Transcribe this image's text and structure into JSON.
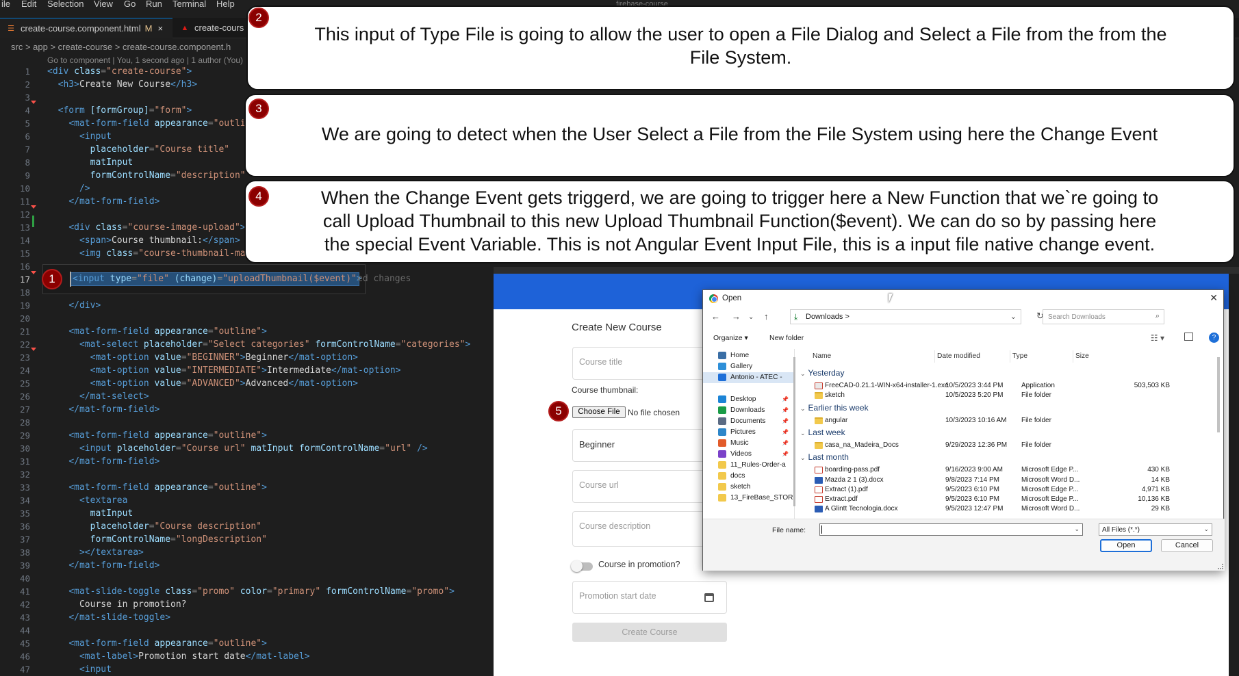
{
  "menu": [
    "ile",
    "Edit",
    "Selection",
    "View",
    "Go",
    "Run",
    "Terminal",
    "Help"
  ],
  "window_title": "firebase-course",
  "tabs": [
    {
      "label": "create-course.component.html",
      "modified": "M",
      "close": "×",
      "active": true
    },
    {
      "label": "create-cours",
      "active": false
    }
  ],
  "breadcrumbs": "src > app > create-course > create-course.component.h",
  "blame": "Go to component | You, 1 second ago | 1 author (You)",
  "code_lines": [
    [
      [
        "t",
        "<div "
      ],
      [
        "a",
        "class"
      ],
      [
        "p",
        "="
      ],
      [
        "s",
        "\"create-course\""
      ],
      [
        "t",
        ">"
      ]
    ],
    [
      [
        "x",
        "  "
      ],
      [
        "t",
        "<h3>"
      ],
      [
        "x",
        "Create New Course"
      ],
      [
        "t",
        "</h3>"
      ]
    ],
    [],
    [
      [
        "x",
        "  "
      ],
      [
        "t",
        "<form "
      ],
      [
        "a",
        "[formGroup]"
      ],
      [
        "p",
        "="
      ],
      [
        "s",
        "\"form\""
      ],
      [
        "t",
        ">"
      ]
    ],
    [
      [
        "x",
        "    "
      ],
      [
        "t",
        "<mat-form-field "
      ],
      [
        "a",
        "appearance"
      ],
      [
        "p",
        "="
      ],
      [
        "s",
        "\"outlin"
      ]
    ],
    [
      [
        "x",
        "      "
      ],
      [
        "t",
        "<input"
      ]
    ],
    [
      [
        "x",
        "        "
      ],
      [
        "a",
        "placeholder"
      ],
      [
        "p",
        "="
      ],
      [
        "s",
        "\"Course title\""
      ]
    ],
    [
      [
        "x",
        "        "
      ],
      [
        "a",
        "matInput"
      ]
    ],
    [
      [
        "x",
        "        "
      ],
      [
        "a",
        "formControlName"
      ],
      [
        "p",
        "="
      ],
      [
        "s",
        "\"description\""
      ]
    ],
    [
      [
        "x",
        "      "
      ],
      [
        "t",
        "/>"
      ]
    ],
    [
      [
        "x",
        "    "
      ],
      [
        "t",
        "</mat-form-field>"
      ]
    ],
    [],
    [
      [
        "x",
        "    "
      ],
      [
        "t",
        "<div "
      ],
      [
        "a",
        "class"
      ],
      [
        "p",
        "="
      ],
      [
        "s",
        "\"course-image-upload\""
      ],
      [
        "t",
        ">"
      ]
    ],
    [
      [
        "x",
        "      "
      ],
      [
        "t",
        "<span>"
      ],
      [
        "x",
        "Course thumbnail:"
      ],
      [
        "t",
        "</span>"
      ]
    ],
    [
      [
        "x",
        "      "
      ],
      [
        "t",
        "<img "
      ],
      [
        "a",
        "class"
      ],
      [
        "p",
        "="
      ],
      [
        "s",
        "\"course-thumbnail-ma"
      ]
    ],
    [],
    [],
    [],
    [
      [
        "x",
        "    "
      ],
      [
        "t",
        "</div>"
      ]
    ],
    [],
    [
      [
        "x",
        "    "
      ],
      [
        "t",
        "<mat-form-field "
      ],
      [
        "a",
        "appearance"
      ],
      [
        "p",
        "="
      ],
      [
        "s",
        "\"outline\""
      ],
      [
        "t",
        ">"
      ]
    ],
    [
      [
        "x",
        "      "
      ],
      [
        "t",
        "<mat-select "
      ],
      [
        "a",
        "placeholder"
      ],
      [
        "p",
        "="
      ],
      [
        "s",
        "\"Select categories\""
      ],
      [
        "x",
        " "
      ],
      [
        "a",
        "formControlName"
      ],
      [
        "p",
        "="
      ],
      [
        "s",
        "\"categories\""
      ],
      [
        "t",
        ">"
      ]
    ],
    [
      [
        "x",
        "        "
      ],
      [
        "t",
        "<mat-option "
      ],
      [
        "a",
        "value"
      ],
      [
        "p",
        "="
      ],
      [
        "s",
        "\"BEGINNER\""
      ],
      [
        "t",
        ">"
      ],
      [
        "x",
        "Beginner"
      ],
      [
        "t",
        "</mat-option>"
      ]
    ],
    [
      [
        "x",
        "        "
      ],
      [
        "t",
        "<mat-option "
      ],
      [
        "a",
        "value"
      ],
      [
        "p",
        "="
      ],
      [
        "s",
        "\"INTERMEDIATE\""
      ],
      [
        "t",
        ">"
      ],
      [
        "x",
        "Intermediate"
      ],
      [
        "t",
        "</mat-option>"
      ]
    ],
    [
      [
        "x",
        "        "
      ],
      [
        "t",
        "<mat-option "
      ],
      [
        "a",
        "value"
      ],
      [
        "p",
        "="
      ],
      [
        "s",
        "\"ADVANCED\""
      ],
      [
        "t",
        ">"
      ],
      [
        "x",
        "Advanced"
      ],
      [
        "t",
        "</mat-option>"
      ]
    ],
    [
      [
        "x",
        "      "
      ],
      [
        "t",
        "</mat-select>"
      ]
    ],
    [
      [
        "x",
        "    "
      ],
      [
        "t",
        "</mat-form-field>"
      ]
    ],
    [],
    [
      [
        "x",
        "    "
      ],
      [
        "t",
        "<mat-form-field "
      ],
      [
        "a",
        "appearance"
      ],
      [
        "p",
        "="
      ],
      [
        "s",
        "\"outline\""
      ],
      [
        "t",
        ">"
      ]
    ],
    [
      [
        "x",
        "      "
      ],
      [
        "t",
        "<input "
      ],
      [
        "a",
        "placeholder"
      ],
      [
        "p",
        "="
      ],
      [
        "s",
        "\"Course url\""
      ],
      [
        "x",
        " "
      ],
      [
        "a",
        "matInput"
      ],
      [
        "x",
        " "
      ],
      [
        "a",
        "formControlName"
      ],
      [
        "p",
        "="
      ],
      [
        "s",
        "\"url\""
      ],
      [
        "x",
        " "
      ],
      [
        "t",
        "/>"
      ]
    ],
    [
      [
        "x",
        "    "
      ],
      [
        "t",
        "</mat-form-field>"
      ]
    ],
    [],
    [
      [
        "x",
        "    "
      ],
      [
        "t",
        "<mat-form-field "
      ],
      [
        "a",
        "appearance"
      ],
      [
        "p",
        "="
      ],
      [
        "s",
        "\"outline\""
      ],
      [
        "t",
        ">"
      ]
    ],
    [
      [
        "x",
        "      "
      ],
      [
        "t",
        "<textarea"
      ]
    ],
    [
      [
        "x",
        "        "
      ],
      [
        "a",
        "matInput"
      ]
    ],
    [
      [
        "x",
        "        "
      ],
      [
        "a",
        "placeholder"
      ],
      [
        "p",
        "="
      ],
      [
        "s",
        "\"Course description\""
      ]
    ],
    [
      [
        "x",
        "        "
      ],
      [
        "a",
        "formControlName"
      ],
      [
        "p",
        "="
      ],
      [
        "s",
        "\"longDescription\""
      ]
    ],
    [
      [
        "x",
        "      "
      ],
      [
        "t",
        "></textarea>"
      ]
    ],
    [
      [
        "x",
        "    "
      ],
      [
        "t",
        "</mat-form-field>"
      ]
    ],
    [],
    [
      [
        "x",
        "    "
      ],
      [
        "t",
        "<mat-slide-toggle "
      ],
      [
        "a",
        "class"
      ],
      [
        "p",
        "="
      ],
      [
        "s",
        "\"promo\""
      ],
      [
        "x",
        " "
      ],
      [
        "a",
        "color"
      ],
      [
        "p",
        "="
      ],
      [
        "s",
        "\"primary\""
      ],
      [
        "x",
        " "
      ],
      [
        "a",
        "formControlName"
      ],
      [
        "p",
        "="
      ],
      [
        "s",
        "\"promo\""
      ],
      [
        "t",
        ">"
      ]
    ],
    [
      [
        "x",
        "      Course in promotion?"
      ]
    ],
    [
      [
        "x",
        "    "
      ],
      [
        "t",
        "</mat-slide-toggle>"
      ]
    ],
    [],
    [
      [
        "x",
        "    "
      ],
      [
        "t",
        "<mat-form-field "
      ],
      [
        "a",
        "appearance"
      ],
      [
        "p",
        "="
      ],
      [
        "s",
        "\"outline\""
      ],
      [
        "t",
        ">"
      ]
    ],
    [
      [
        "x",
        "      "
      ],
      [
        "t",
        "<mat-label>"
      ],
      [
        "x",
        "Promotion start date"
      ],
      [
        "t",
        "</mat-label>"
      ]
    ],
    [
      [
        "x",
        "      "
      ],
      [
        "t",
        "<input"
      ]
    ]
  ],
  "highlighted_line": {
    "number": "17",
    "tokens": [
      [
        "t",
        "<input "
      ],
      [
        "a",
        "type"
      ],
      [
        "p",
        "="
      ],
      [
        "s",
        "\"file\""
      ],
      [
        "x",
        " "
      ],
      [
        "a",
        "(change)"
      ],
      [
        "p",
        "="
      ],
      [
        "s",
        "\"uploadThumbnail($event)\""
      ],
      [
        "t",
        ">"
      ]
    ],
    "ghost": "ed changes"
  },
  "callouts": [
    {
      "badge": "2",
      "lines": [
        "This input of Type File is going to allow the user to open a File Dialog and Select a File from the from the",
        "File System."
      ]
    },
    {
      "badge": "3",
      "lines": [
        "We are going to detect when the User Select a File from the File System using here the Change Event"
      ]
    },
    {
      "badge": "4",
      "lines": [
        "When the Change Event gets triggerd, we are going to trigger here a New Function that we`re going to",
        "call Upload Thumbnail to this new Upload Thumbnail Function($event). We can do so by passing here",
        "the special Event Variable. This is not Angular Event Input File, this is a input file native change event."
      ]
    }
  ],
  "badges": {
    "one": "1",
    "five": "5"
  },
  "app": {
    "title": "Create New Course",
    "course_title_ph": "Course title",
    "thumbnail_label": "Course thumbnail:",
    "choose_file": "Choose File",
    "no_file": "No file chosen",
    "category": "Beginner",
    "url_ph": "Course url",
    "description_ph": "Course description",
    "promo_label": "Course in promotion?",
    "promo_date_ph": "Promotion start date",
    "create_button": "Create Course",
    "accent": "#1e62d8"
  },
  "dialog": {
    "title": "Open",
    "address": "Downloads  >",
    "search_ph": "Search Downloads",
    "organize": "Organize ▾",
    "new_folder": "New folder",
    "nav": [
      {
        "label": "Home",
        "icon": "home-icon",
        "color": "#3a6ea5",
        "pin": false
      },
      {
        "label": "Gallery",
        "icon": "gallery-icon",
        "color": "#2e8fd8",
        "pin": false
      },
      {
        "label": "Antonio - ATEC -",
        "icon": "cloud-icon",
        "color": "#1e6fd8",
        "pin": false,
        "selected": true
      },
      {
        "label": "Desktop",
        "icon": "desktop-icon",
        "color": "#1c84d6",
        "pin": true
      },
      {
        "label": "Downloads",
        "icon": "download-icon",
        "color": "#1a9c47",
        "pin": true
      },
      {
        "label": "Documents",
        "icon": "documents-icon",
        "color": "#5b6b84",
        "pin": true
      },
      {
        "label": "Pictures",
        "icon": "pictures-icon",
        "color": "#2d86c9",
        "pin": true
      },
      {
        "label": "Music",
        "icon": "music-icon",
        "color": "#e25b2a",
        "pin": true
      },
      {
        "label": "Videos",
        "icon": "videos-icon",
        "color": "#7b42c9",
        "pin": true
      },
      {
        "label": "11_Rules-Order-a",
        "icon": "folder-icon",
        "color": "#f2c94c",
        "pin": false
      },
      {
        "label": "docs",
        "icon": "folder-icon",
        "color": "#f2c94c",
        "pin": false
      },
      {
        "label": "sketch",
        "icon": "folder-icon",
        "color": "#f2c94c",
        "pin": false
      },
      {
        "label": "13_FireBase_STOR",
        "icon": "folder-icon",
        "color": "#f2c94c",
        "pin": false
      }
    ],
    "columns": [
      "Name",
      "Date modified",
      "Type",
      "Size"
    ],
    "groups": [
      {
        "label": "Yesterday",
        "files": [
          {
            "name": "FreeCAD-0.21.1-WIN-x64-installer-1.exe",
            "date": "10/5/2023 3:44 PM",
            "type": "Application",
            "size": "503,503 KB",
            "kind": "exe"
          },
          {
            "name": "sketch",
            "date": "10/5/2023 5:20 PM",
            "type": "File folder",
            "size": "",
            "kind": "folder"
          }
        ]
      },
      {
        "label": "Earlier this week",
        "files": [
          {
            "name": "angular",
            "date": "10/3/2023 10:16 AM",
            "type": "File folder",
            "size": "",
            "kind": "folder"
          }
        ]
      },
      {
        "label": "Last week",
        "files": [
          {
            "name": "casa_na_Madeira_Docs",
            "date": "9/29/2023 12:36 PM",
            "type": "File folder",
            "size": "",
            "kind": "folder"
          }
        ]
      },
      {
        "label": "Last month",
        "files": [
          {
            "name": "boarding-pass.pdf",
            "date": "9/16/2023 9:00 AM",
            "type": "Microsoft Edge P...",
            "size": "430 KB",
            "kind": "pdf"
          },
          {
            "name": "Mazda 2  1 (3).docx",
            "date": "9/8/2023 7:14 PM",
            "type": "Microsoft Word D...",
            "size": "14 KB",
            "kind": "word"
          },
          {
            "name": "Extract (1).pdf",
            "date": "9/5/2023 6:10 PM",
            "type": "Microsoft Edge P...",
            "size": "4,971 KB",
            "kind": "pdf"
          },
          {
            "name": "Extract.pdf",
            "date": "9/5/2023 6:10 PM",
            "type": "Microsoft Edge P...",
            "size": "10,136 KB",
            "kind": "pdf"
          },
          {
            "name": "A Glintt Tecnologia.docx",
            "date": "9/5/2023 12:47 PM",
            "type": "Microsoft Word D...",
            "size": "29 KB",
            "kind": "word"
          }
        ]
      }
    ],
    "file_name_label": "File name:",
    "file_name_value": "",
    "filter": "All Files (*.*)",
    "open_button": "Open",
    "cancel_button": "Cancel"
  }
}
